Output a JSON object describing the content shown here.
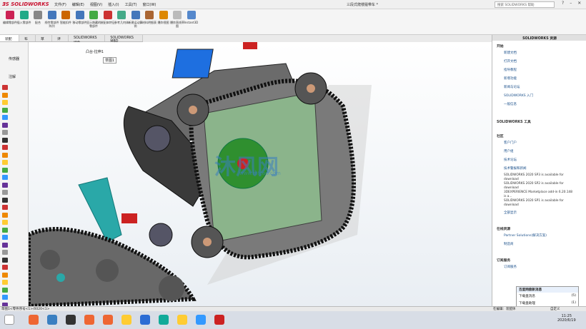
{
  "app": {
    "logo": "SOLIDWORKS",
    "doc_title": "三段式爬楼履带车 *",
    "search": "搜索 SOLIDWORKS 帮助"
  },
  "menu": [
    "文件(F)",
    "编辑(E)",
    "视图(V)",
    "插入(I)",
    "工具(T)",
    "窗口(W)"
  ],
  "ribbon": [
    {
      "label": "编辑零部件",
      "color": "#c25"
    },
    {
      "label": "插入零部件",
      "color": "#2a8"
    },
    {
      "label": "配合",
      "color": "#888"
    },
    {
      "label": "线性零部件阵列",
      "color": "#47b"
    },
    {
      "label": "智能扣件",
      "color": "#c60"
    },
    {
      "label": "移动零部件",
      "color": "#47b"
    },
    {
      "label": "显示隐藏的零部件",
      "color": "#4a4"
    },
    {
      "label": "装配体特征",
      "color": "#c33"
    },
    {
      "label": "参考几何体",
      "color": "#4a8"
    },
    {
      "label": "新建运动算例",
      "color": "#47b"
    },
    {
      "label": "材料明细表",
      "color": "#a63"
    },
    {
      "label": "爆炸视图",
      "color": "#d80"
    },
    {
      "label": "爆炸直线草图",
      "color": "#bbb"
    },
    {
      "label": "Instant3D",
      "color": "#58c"
    }
  ],
  "tabs": [
    "装配体",
    "布局",
    "草图",
    "评估",
    "SOLIDWORKS 插件",
    "SOLIDWORKS MBD"
  ],
  "tree": {
    "label": "凸台-拉伸1",
    "sub": "草图1"
  },
  "left_labels": {
    "a": "传感器",
    "b": "注解"
  },
  "right_panel": {
    "title": "SOLIDWORKS 资源",
    "start": "开始",
    "start_items": [
      "新建文档",
      "打开文档",
      "指导教程",
      "新增功能",
      "新闻与论坛",
      "SOLIDWORKS 入门",
      "一般信息"
    ],
    "tools": "SOLIDWORKS 工具",
    "community": "社区",
    "community_items": [
      "客户门户",
      "用户组",
      "技术论坛",
      "技术警报和新闻"
    ],
    "news": [
      "SOLIDWORKS 2020 SP3 is available for download",
      "SOLIDWORKS 2020 SP2 is available for download",
      "3DEXPERIENCE Marketplace add-in 6.20.148 is a...",
      "SOLIDWORKS 2020 SP1 is available for download"
    ],
    "more": "全部显示",
    "partners": "在线资源",
    "partners_items": [
      "Partner Solutions(解决方案)",
      "制造商"
    ],
    "subscribe": "订阅服务",
    "subscribe_item": "订阅服务"
  },
  "status": {
    "left": "草图1<零件序号<1>/0020<1>",
    "mid": "在编辑：装配体",
    "right": "自定义"
  },
  "notification": {
    "title": "百度网盘新消息",
    "rows": [
      {
        "label": "下载盘消息",
        "count": "(5)"
      },
      {
        "label": "下载盘助理",
        "count": "(1)"
      }
    ]
  },
  "clock": {
    "time": "11:25",
    "date": "2020/6/19"
  },
  "watermark": "沐风网",
  "watermark_sub": "www.mfcad.com"
}
